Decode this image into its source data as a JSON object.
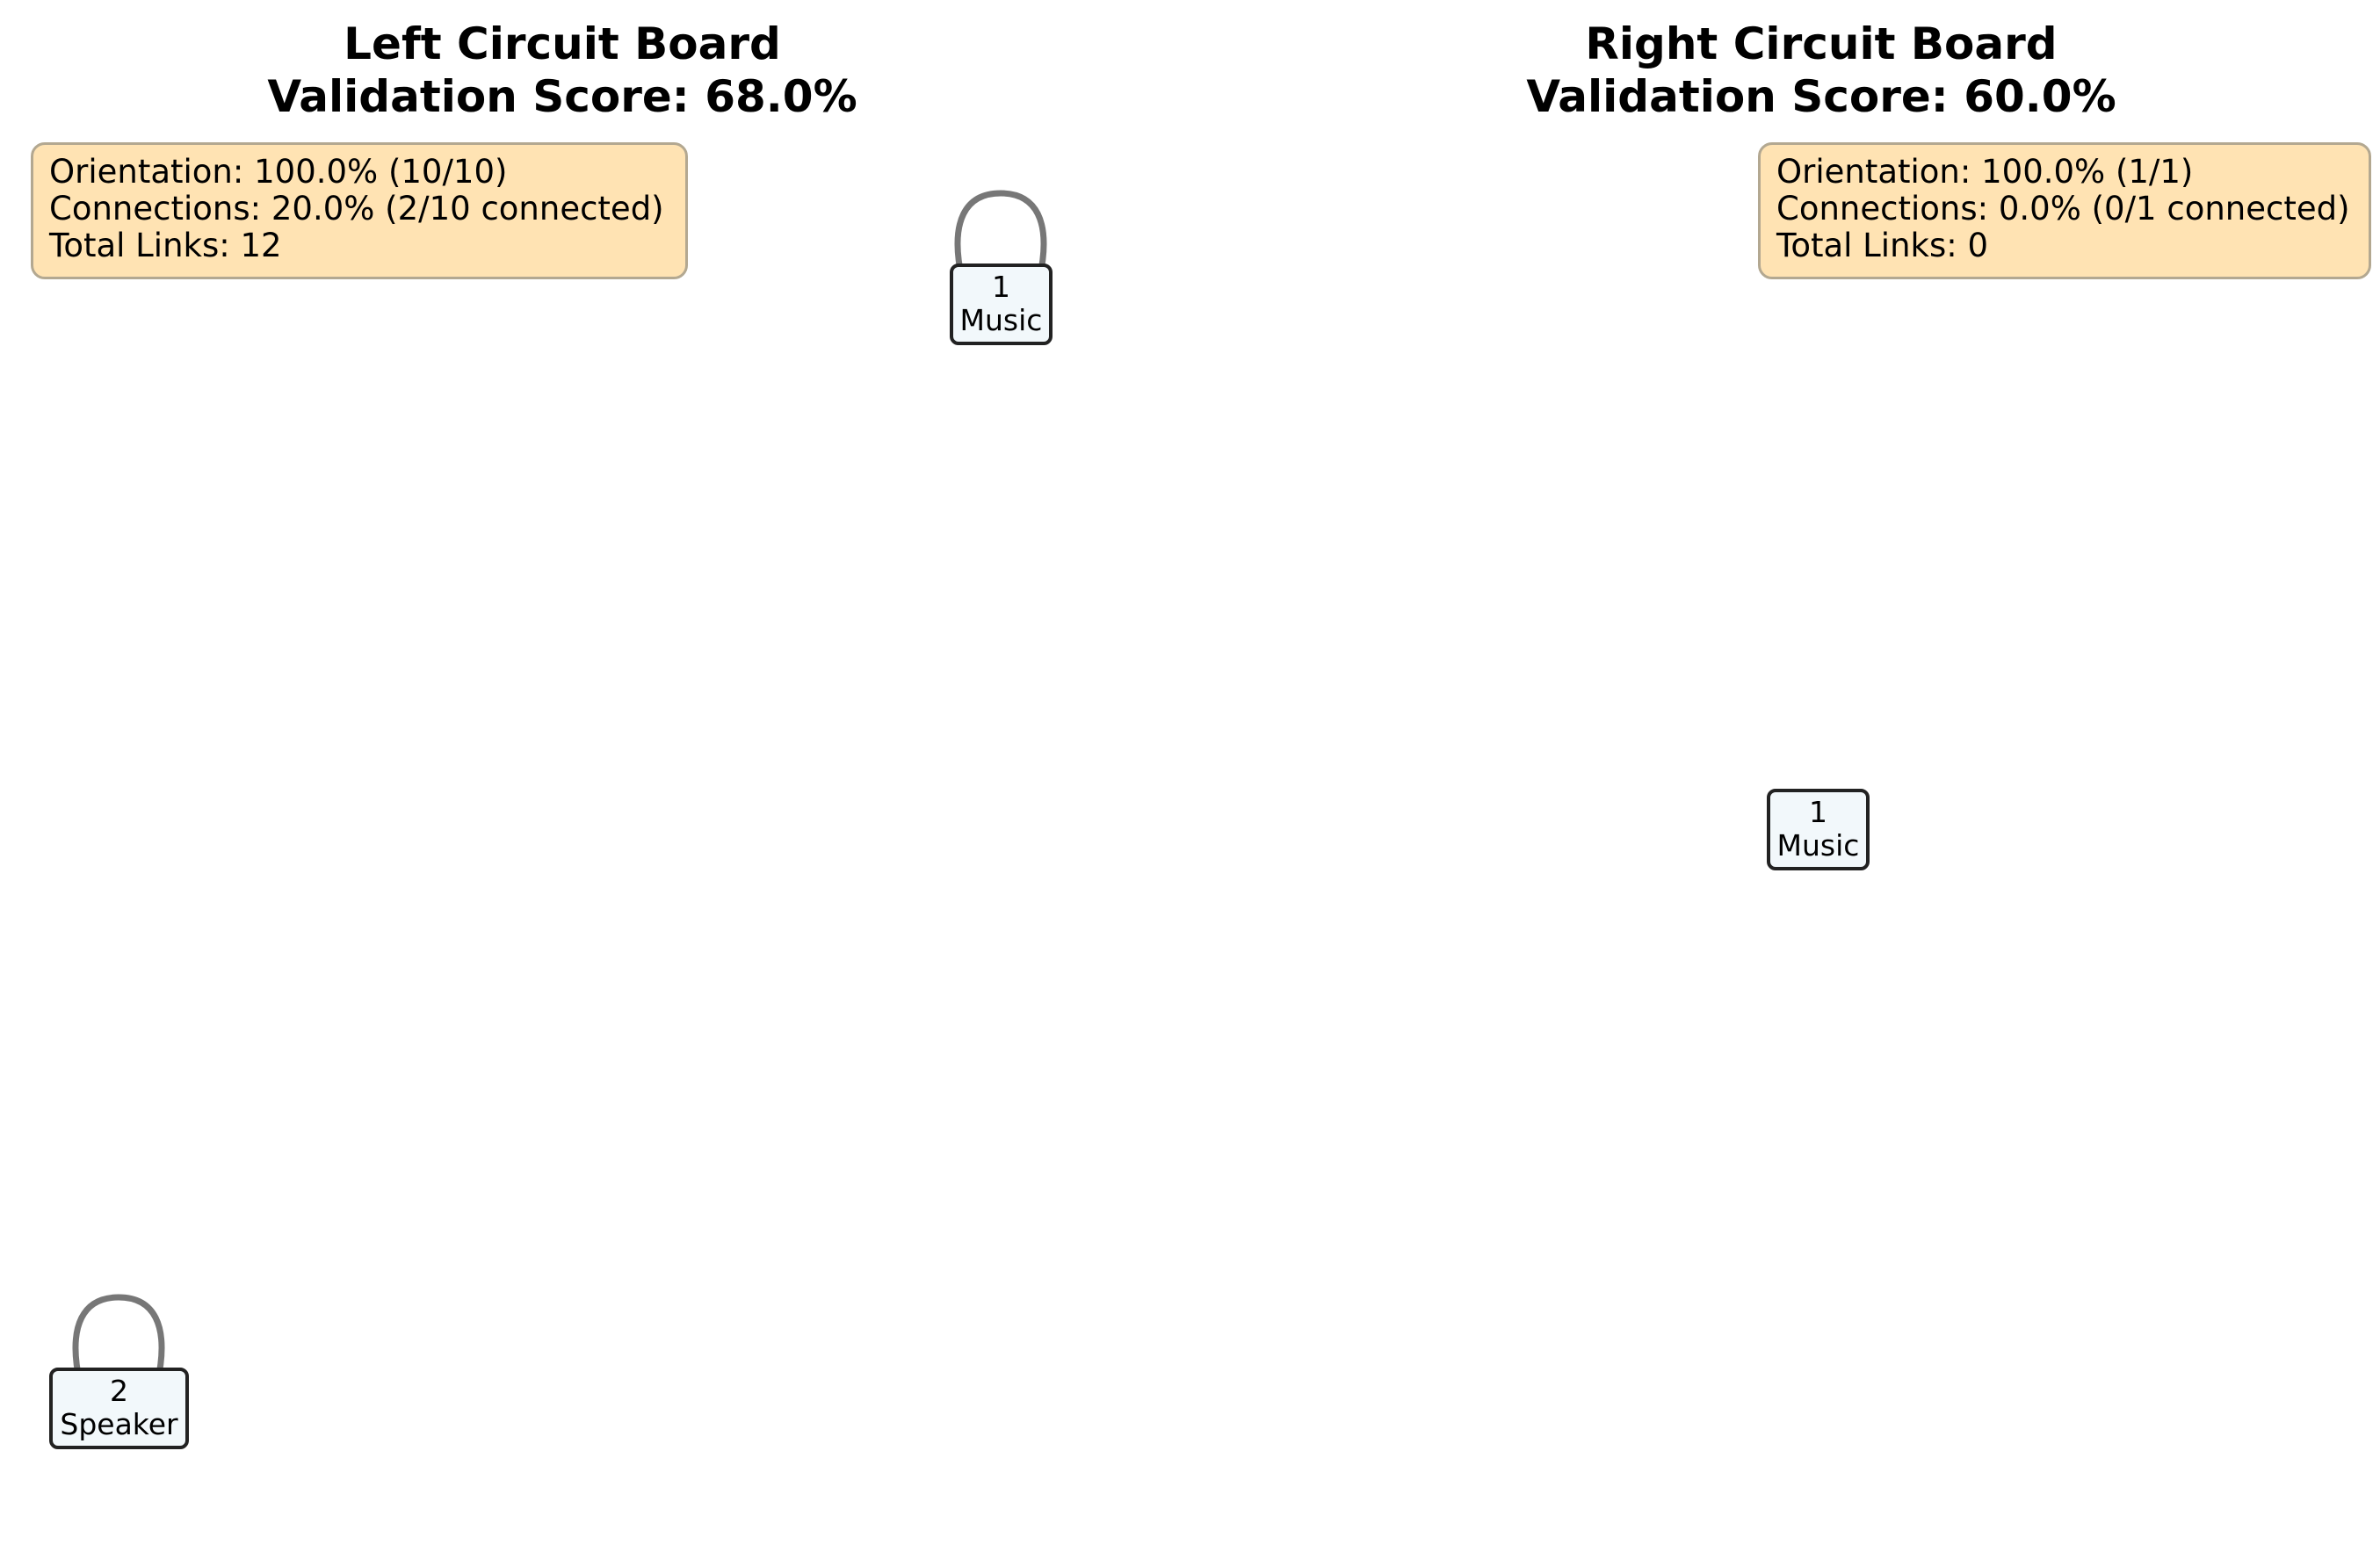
{
  "left_board": {
    "title": "Left Circuit Board",
    "score": "Validation Score: 68.0%",
    "info": {
      "orientation": "Orientation: 100.0% (10/10)",
      "connections": "Connections: 20.0% (2/10 connected)",
      "total_links": "Total Links: 12"
    },
    "nodes": [
      {
        "number": "1",
        "label": "Music"
      },
      {
        "number": "2",
        "label": "Speaker"
      }
    ]
  },
  "right_board": {
    "title": "Right Circuit Board",
    "score": "Validation Score: 60.0%",
    "info": {
      "orientation": "Orientation: 100.0% (1/1)",
      "connections": "Connections: 0.0% (0/1 connected)",
      "total_links": "Total Links: 0"
    },
    "nodes": [
      {
        "number": "1",
        "label": "Music"
      }
    ]
  },
  "colors": {
    "info_box_fill": "#ffe3b3",
    "info_box_border": "#b3a891",
    "node_fill": "#f2f8fb",
    "node_border": "#222222",
    "link_stroke": "#777777"
  }
}
